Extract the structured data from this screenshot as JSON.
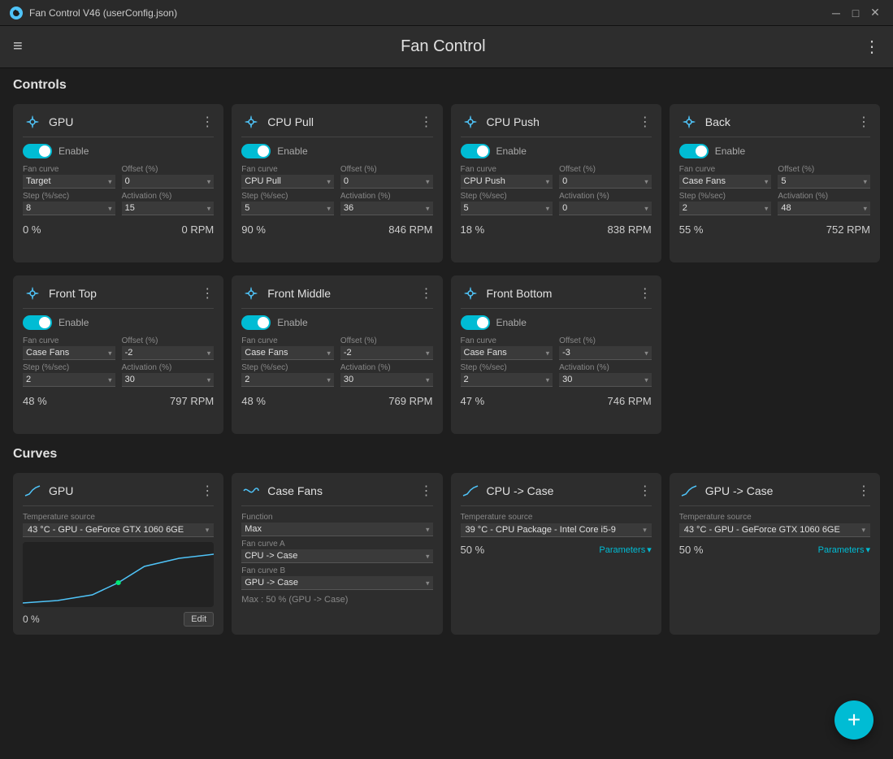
{
  "titlebar": {
    "title": "Fan Control V46 (userConfig.json)",
    "min_btn": "─",
    "max_btn": "□",
    "close_btn": "✕"
  },
  "header": {
    "title": "Fan Control",
    "menu_icon": "≡",
    "more_icon": "⋮"
  },
  "controls_section": {
    "label": "Controls",
    "row1": [
      {
        "id": "gpu",
        "title": "GPU",
        "enabled": true,
        "fan_curve_label": "Fan curve",
        "fan_curve": "Target",
        "offset_label": "Offset (%)",
        "offset": "0",
        "step_label": "Step (%/sec)",
        "step": "8",
        "activation_label": "Activation (%)",
        "activation": "15",
        "percent": "0 %",
        "rpm": "0 RPM"
      },
      {
        "id": "cpu_pull",
        "title": "CPU Pull",
        "enabled": true,
        "fan_curve_label": "Fan curve",
        "fan_curve": "CPU Pull",
        "offset_label": "Offset (%)",
        "offset": "0",
        "step_label": "Step (%/sec)",
        "step": "5",
        "activation_label": "Activation (%)",
        "activation": "36",
        "percent": "90 %",
        "rpm": "846 RPM"
      },
      {
        "id": "cpu_push",
        "title": "CPU Push",
        "enabled": true,
        "fan_curve_label": "Fan curve",
        "fan_curve": "CPU Push",
        "offset_label": "Offset (%)",
        "offset": "0",
        "step_label": "Step (%/sec)",
        "step": "5",
        "activation_label": "Activation (%)",
        "activation": "0",
        "percent": "18 %",
        "rpm": "838 RPM"
      },
      {
        "id": "back",
        "title": "Back",
        "enabled": true,
        "fan_curve_label": "Fan curve",
        "fan_curve": "Case Fans",
        "offset_label": "Offset (%)",
        "offset": "5",
        "step_label": "Step (%/sec)",
        "step": "2",
        "activation_label": "Activation (%)",
        "activation": "48",
        "percent": "55 %",
        "rpm": "752 RPM"
      }
    ],
    "row2": [
      {
        "id": "front_top",
        "title": "Front Top",
        "enabled": true,
        "fan_curve_label": "Fan curve",
        "fan_curve": "Case Fans",
        "offset_label": "Offset (%)",
        "offset": "-2",
        "step_label": "Step (%/sec)",
        "step": "2",
        "activation_label": "Activation (%)",
        "activation": "30",
        "percent": "48 %",
        "rpm": "797 RPM"
      },
      {
        "id": "front_middle",
        "title": "Front Middle",
        "enabled": true,
        "fan_curve_label": "Fan curve",
        "fan_curve": "Case Fans",
        "offset_label": "Offset (%)",
        "offset": "-2",
        "step_label": "Step (%/sec)",
        "step": "2",
        "activation_label": "Activation (%)",
        "activation": "30",
        "percent": "48 %",
        "rpm": "769 RPM"
      },
      {
        "id": "front_bottom",
        "title": "Front Bottom",
        "enabled": true,
        "fan_curve_label": "Fan curve",
        "fan_curve": "Case Fans",
        "offset_label": "Offset (%)",
        "offset": "-3",
        "step_label": "Step (%/sec)",
        "step": "2",
        "activation_label": "Activation (%)",
        "activation": "30",
        "percent": "47 %",
        "rpm": "746 RPM"
      }
    ]
  },
  "curves_section": {
    "label": "Curves",
    "items": [
      {
        "id": "gpu_curve",
        "title": "GPU",
        "type": "linear",
        "temp_source_label": "Temperature source",
        "temp_source": "43 °C - GPU - GeForce GTX 1060 6GE",
        "percent": "0 %",
        "edit_label": "Edit"
      },
      {
        "id": "case_fans_curve",
        "title": "Case Fans",
        "type": "mix",
        "function_label": "Function",
        "function": "Max",
        "fan_curve_a_label": "Fan curve A",
        "fan_curve_a": "CPU -> Case",
        "fan_curve_b_label": "Fan curve B",
        "fan_curve_b": "GPU -> Case",
        "result": "Max : 50 % (GPU -> Case)"
      },
      {
        "id": "cpu_case_curve",
        "title": "CPU -> Case",
        "type": "linear",
        "temp_source_label": "Temperature source",
        "temp_source": "39 °C - CPU Package - Intel Core i5-9",
        "percent": "50 %",
        "parameters_label": "Parameters"
      },
      {
        "id": "gpu_case_curve",
        "title": "GPU -> Case",
        "type": "linear",
        "temp_source_label": "Temperature source",
        "temp_source": "43 °C - GPU - GeForce GTX 1060 6GE",
        "percent": "50 %",
        "parameters_label": "Parameters"
      }
    ]
  },
  "fab": {
    "label": "+"
  }
}
